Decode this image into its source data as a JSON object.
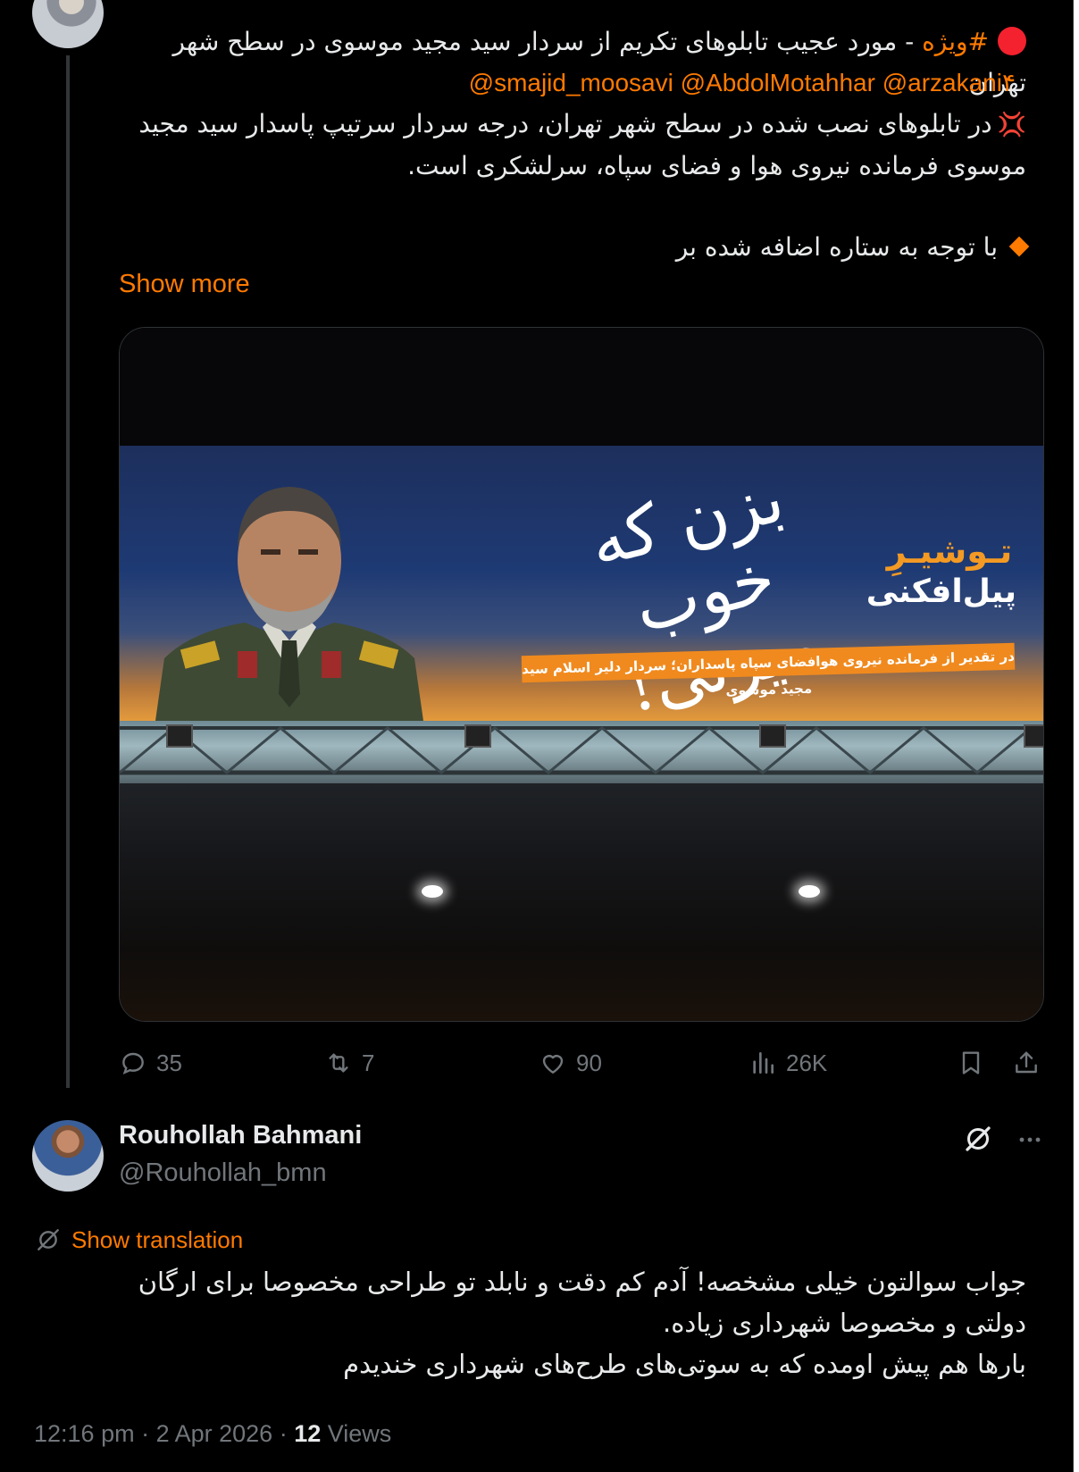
{
  "tweet": {
    "line1_hashtag": "#ویژه",
    "line1_rest": " - مورد عجیب تابلوهای تکریم از سردار سید مجید موسوی در سطح شهر تهران",
    "mentions": "@smajid_moosavi @AbdolMotahhar @arzakani۴",
    "line3": "در تابلوهای نصب شده در سطح شهر تهران، درجه سردار سرتیپ پاسدار سید مجید موسوی فرمانده نیروی هوا و فضای سپاه، سرلشکری است.",
    "line4": "با توجه به ستاره اضافه شده بر",
    "show_more": "Show more",
    "media": {
      "slogan": "بزن که خوب میزنی!",
      "tag_line1": "تـوشیـرِ",
      "tag_line2": "پیل‌افکنی",
      "subtitle": "در تقدیر از فرمانده نیروی هوافضای سپاه پاسداران؛ سردار دلیر اسلام سید مجید موسوی"
    },
    "stats": {
      "replies": "35",
      "retweets": "7",
      "likes": "90",
      "views": "26K"
    }
  },
  "reply": {
    "name": "Rouhollah Bahmani",
    "handle": "@Rouhollah_bmn",
    "show_translation": "Show translation",
    "line1": "جواب سوالتون خیلی مشخصه! آدم کم دقت و نابلد تو طراحی مخصوصا برای ارگان",
    "line2": "دولتی و مخصوصا شهرداری زیاده.",
    "line3": "بارها هم پیش اومده که به سوتی‌های طرح‌های شهرداری خندیدم",
    "time": "12:16 pm",
    "separator": " · ",
    "date": "2 Apr 2026",
    "views_count": "12",
    "views_label": " Views"
  },
  "colors": {
    "accent": "#ff7a00",
    "background": "#000000",
    "text": "#e7e9ea",
    "muted": "#71767b",
    "red": "#f4212e"
  }
}
